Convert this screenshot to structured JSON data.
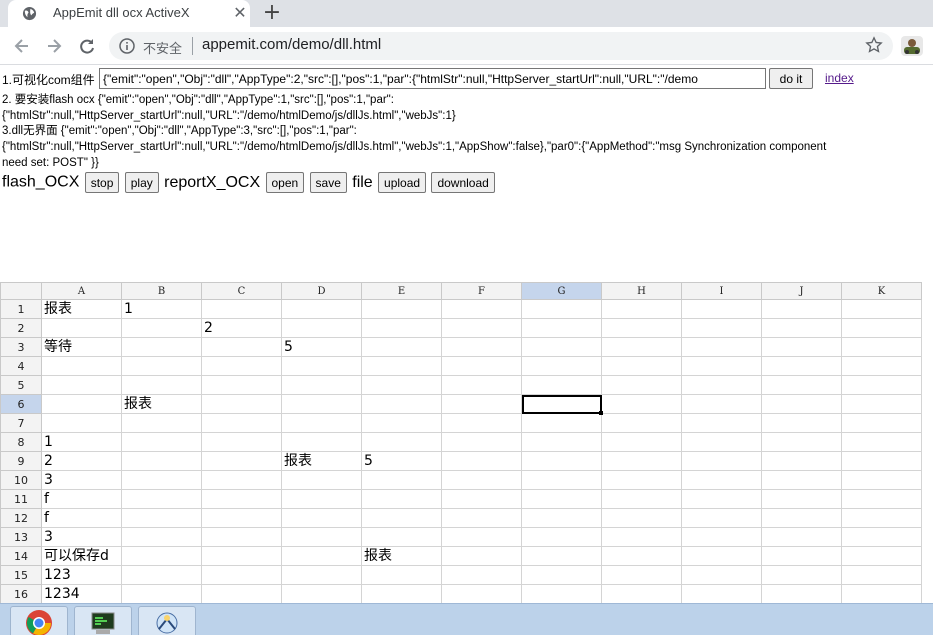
{
  "tab": {
    "title": "AppEmit dll ocx ActiveX",
    "close_glyph": "✕",
    "new_tab_glyph": "+",
    "favicon": "globe-icon"
  },
  "toolbar": {
    "security_label": "不安全",
    "url": "appemit.com/demo/dll.html",
    "back_icon": "back-arrow-icon",
    "forward_icon": "forward-arrow-icon",
    "reload_icon": "reload-icon",
    "star_icon": "star-icon"
  },
  "page": {
    "row1_label": "1.可视化com组件",
    "row1_input_value": "{\"emit\":\"open\",\"Obj\":\"dll\",\"AppType\":2,\"src\":[],\"pos\":1,\"par\":{\"htmlStr\":null,\"HttpServer_startUrl\":null,\"URL\":\"/demo",
    "doit_label": "do it",
    "index_link": "index",
    "para2_line1": "2. 要安装flash ocx  {\"emit\":\"open\",\"Obj\":\"dll\",\"AppType\":1,\"src\":[],\"pos\":1,\"par\":",
    "para2_line2": "{\"htmlStr\":null,\"HttpServer_startUrl\":null,\"URL\":\"/demo/htmlDemo/js/dllJs.html\",\"webJs\":1}",
    "para3_line1": "3.dll无界面  {\"emit\":\"open\",\"Obj\":\"dll\",\"AppType\":3,\"src\":[],\"pos\":1,\"par\":",
    "para3_line2": "{\"htmlStr\":null,\"HttpServer_startUrl\":null,\"URL\":\"/demo/htmlDemo/js/dllJs.html\",\"webJs\":1,\"AppShow\":false},\"par0\":{\"AppMethod\":\"msg Synchronization component",
    "para3_line3": "need set: POST\" }}",
    "flash_label": "flash_OCX",
    "stop_label": "stop",
    "play_label": "play",
    "report_label": "reportX_OCX",
    "open_label": "open",
    "save_label": "save",
    "file_label": "file",
    "upload_label": "upload",
    "download_label": "download"
  },
  "sheet": {
    "columns": [
      "A",
      "B",
      "C",
      "D",
      "E",
      "F",
      "G",
      "H",
      "I",
      "J",
      "K"
    ],
    "selected_column": "G",
    "selected_row": 6,
    "rows": [
      {
        "n": "1",
        "cells": [
          "报表",
          "1",
          "",
          "",
          "",
          "",
          "",
          "",
          "",
          "",
          ""
        ]
      },
      {
        "n": "2",
        "cells": [
          "",
          "",
          "2",
          "",
          "",
          "",
          "",
          "",
          "",
          "",
          ""
        ]
      },
      {
        "n": "3",
        "cells": [
          "等待",
          "",
          "",
          "5",
          "",
          "",
          "",
          "",
          "",
          "",
          ""
        ]
      },
      {
        "n": "4",
        "cells": [
          "",
          "",
          "",
          "",
          "",
          "",
          "",
          "",
          "",
          "",
          ""
        ]
      },
      {
        "n": "5",
        "cells": [
          "",
          "",
          "",
          "",
          "",
          "",
          "",
          "",
          "",
          "",
          ""
        ]
      },
      {
        "n": "6",
        "cells": [
          "",
          "报表",
          "",
          "",
          "",
          "",
          "",
          "",
          "",
          "",
          ""
        ]
      },
      {
        "n": "7",
        "cells": [
          "",
          "",
          "",
          "",
          "",
          "",
          "",
          "",
          "",
          "",
          ""
        ]
      },
      {
        "n": "8",
        "cells": [
          "1",
          "",
          "",
          "",
          "",
          "",
          "",
          "",
          "",
          "",
          ""
        ]
      },
      {
        "n": "9",
        "cells": [
          "2",
          "",
          "",
          "报表",
          "5",
          "",
          "",
          "",
          "",
          "",
          ""
        ]
      },
      {
        "n": "10",
        "cells": [
          "3",
          "",
          "",
          "",
          "",
          "",
          "",
          "",
          "",
          "",
          ""
        ]
      },
      {
        "n": "11",
        "cells": [
          "f",
          "",
          "",
          "",
          "",
          "",
          "",
          "",
          "",
          "",
          ""
        ]
      },
      {
        "n": "12",
        "cells": [
          "f",
          "",
          "",
          "",
          "",
          "",
          "",
          "",
          "",
          "",
          ""
        ]
      },
      {
        "n": "13",
        "cells": [
          "3",
          "",
          "",
          "",
          "",
          "",
          "",
          "",
          "",
          "",
          ""
        ]
      },
      {
        "n": "14",
        "cells": [
          "可以保存d",
          "",
          "",
          "",
          "报表",
          "",
          "",
          "",
          "",
          "",
          ""
        ]
      },
      {
        "n": "15",
        "cells": [
          "123",
          "",
          "",
          "",
          "",
          "",
          "",
          "",
          "",
          "",
          ""
        ]
      },
      {
        "n": "16",
        "cells": [
          "1234",
          "",
          "",
          "",
          "",
          "",
          "",
          "",
          "",
          "",
          ""
        ]
      }
    ]
  },
  "taskbar": {
    "items": [
      "chrome-icon",
      "terminal-icon",
      "app-icon"
    ]
  }
}
